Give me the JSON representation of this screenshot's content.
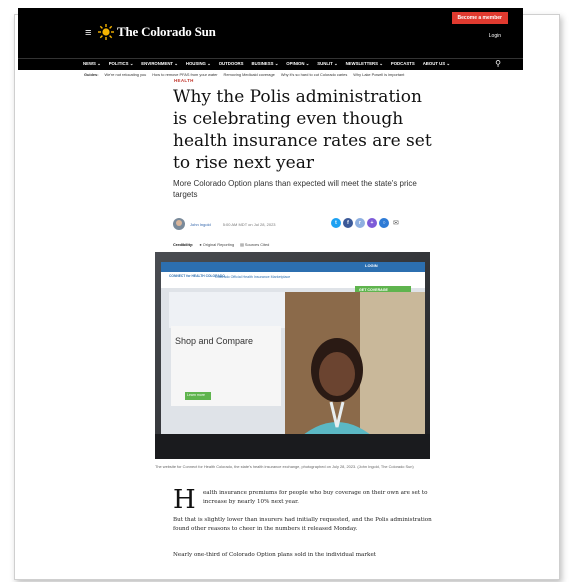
{
  "site": {
    "name": "The Colorado Sun",
    "member_label": "Become a member",
    "login_label": "Login"
  },
  "nav": {
    "items": [
      "NEWS ⌄",
      "POLITICS ⌄",
      "ENVIRONMENT ⌄",
      "HOUSING ⌄",
      "OUTDOORS",
      "BUSINESS ⌄",
      "OPINION ⌄",
      "SUNLIT ⌄",
      "NEWSLETTERS ⌄",
      "PODCASTS",
      "ABOUT US ⌄"
    ]
  },
  "guides": {
    "label": "Guides:",
    "items": [
      "We're not relocating you",
      "How to remove PFAS from your water",
      "Removing Medicaid coverage",
      "Why it's so hard to cut Colorado caries",
      "Why Lake Powell is important"
    ]
  },
  "article": {
    "section": "HEALTH",
    "headline": "Why the Polis administration is celebrating even though health insurance rates are set to rise next year",
    "dek": "More Colorado Option plans than expected will meet the state's price targets",
    "author": "John Ingold",
    "date": "5:00 AM MDT on Jul 28, 2023",
    "credibility": {
      "label": "Credibility:",
      "items": [
        "Original Reporting",
        "Sources Cited"
      ]
    },
    "caption": "The website for Connect for Health Colorado, the state's health insurance exchange, photographed on July 28, 2023. (John Ingold, The Colorado Sun)",
    "dropcap": "H",
    "p1": "ealth insurance premiums for people who buy coverage on their own are set to increase by nearly 10% next year.",
    "p2": "But that is slightly lower than insurers had initially requested, and the Polis administration found other reasons to cheer in the numbers it released Monday.",
    "p3": "Nearly one-third of Colorado Option plans sold in the individual market"
  },
  "photo": {
    "site_logo": "CONNECT for HEALTH COLORADO",
    "site_title": "Colorado Official Health Insurance Marketplace",
    "login": "LOGIN",
    "cta": "GET COVERAGE",
    "shop": "Shop and Compare",
    "shop_btn": "Learn more"
  },
  "share_colors": [
    "#1da1f2",
    "#3b5998",
    "#8fb0e0",
    "#7d5bd8",
    "#2e7bd6"
  ],
  "colors": {
    "accent": "#e03a2f",
    "link": "#2a5fa8"
  }
}
